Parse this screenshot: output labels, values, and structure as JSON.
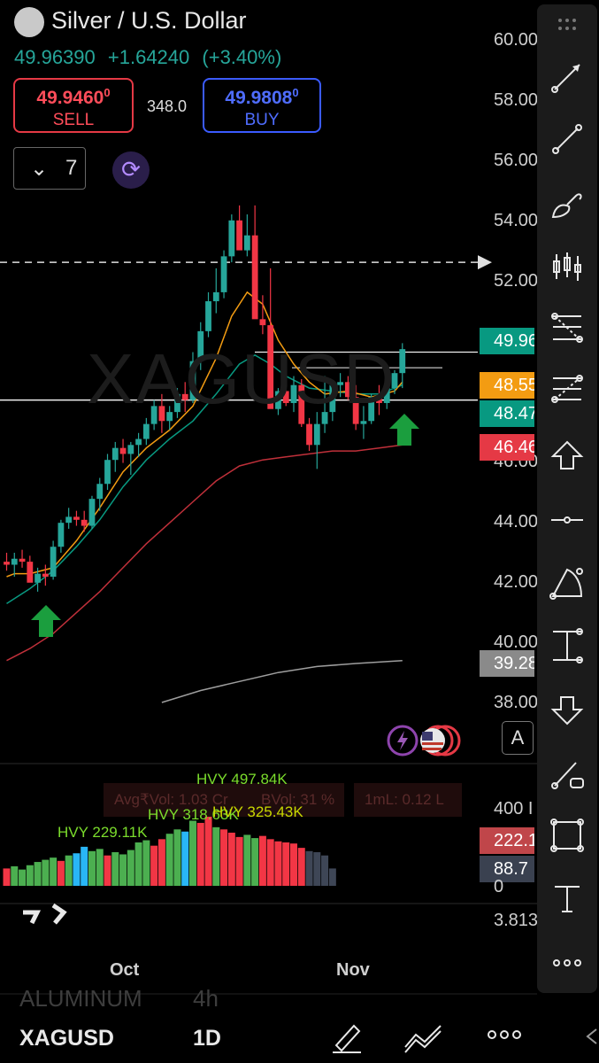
{
  "header": {
    "symbol_name": "Silver / U.S. Dollar",
    "last_price": "49.96390",
    "change_abs": "+1.64240",
    "change_pct": "(+3.40%)"
  },
  "trade": {
    "sell_price": "49.9460",
    "sell_price_sup": "0",
    "sell_label": "SELL",
    "spread": "348.0",
    "buy_price": "49.9808",
    "buy_price_sup": "0",
    "buy_label": "BUY"
  },
  "interval_selector": {
    "value": "7"
  },
  "watermark": "XAGUSD",
  "price_axis": [
    "60.00",
    "58.00",
    "56.00",
    "54.00",
    "52.00",
    "46.00",
    "44.00",
    "42.00",
    "40.00",
    "38.00"
  ],
  "price_tags": [
    {
      "label": "49.96",
      "color": "#089981"
    },
    {
      "label": "48.55",
      "color": "#f39c12"
    },
    {
      "label": "48.47",
      "color": "#089981"
    },
    {
      "label": "46.46",
      "color": "#e53945"
    },
    {
      "label": "39.28",
      "color": "#8a8a8a"
    }
  ],
  "volume_pane": {
    "avg_vol": "Avg₹Vol: 1.03 Cr",
    "bvol": "BVol: 31 %",
    "ml": "1mL: 0.12 L",
    "hvy_labels": [
      "HVY 497.84K",
      "HVY 229.11K",
      "HVY 318.63K",
      "HVY 325.43K"
    ],
    "axis_top": "400 I",
    "tag_red": "222.1",
    "tag_dark": "88.7",
    "axis_zero": "0",
    "osc_value": "3.813"
  },
  "time_axis": [
    "Oct",
    "Nov"
  ],
  "alert_label": "A",
  "bottom_bar": {
    "symbol": "XAGUSD",
    "interval": "1D",
    "ghost_symbol": "ALUMINUM",
    "ghost_interval": "4h"
  },
  "colors": {
    "up": "#26a69a",
    "down": "#f23645",
    "ema_fast": "#f39c12",
    "ema_mid": "#089981",
    "ema_slow": "#c0303a",
    "sma_long": "#9e9e9e",
    "vol_green": "#4caf50",
    "vol_red": "#f23645",
    "vol_blue": "#29b6f6"
  },
  "chart_data": {
    "type": "candlestick",
    "price_range": [
      37,
      61
    ],
    "candles": [
      [
        42.6,
        42.9,
        42.3,
        42.5
      ],
      [
        42.5,
        42.9,
        42.1,
        42.7
      ],
      [
        42.7,
        43.0,
        42.4,
        42.6
      ],
      [
        42.6,
        42.8,
        42.0,
        41.9
      ],
      [
        41.9,
        42.4,
        41.6,
        42.2
      ],
      [
        42.2,
        42.5,
        41.8,
        42.1
      ],
      [
        42.1,
        43.3,
        42.0,
        43.1
      ],
      [
        43.1,
        44.0,
        42.9,
        43.9
      ],
      [
        43.9,
        44.4,
        43.7,
        44.1
      ],
      [
        44.1,
        44.3,
        43.8,
        44.0
      ],
      [
        44.0,
        44.3,
        43.6,
        43.8
      ],
      [
        43.8,
        44.8,
        43.7,
        44.7
      ],
      [
        44.7,
        45.4,
        44.3,
        45.2
      ],
      [
        45.2,
        46.2,
        45.0,
        46.0
      ],
      [
        46.0,
        46.6,
        45.6,
        46.4
      ],
      [
        46.4,
        46.7,
        45.9,
        46.2
      ],
      [
        46.2,
        46.6,
        45.5,
        46.5
      ],
      [
        46.5,
        46.9,
        46.1,
        46.7
      ],
      [
        46.7,
        47.4,
        46.5,
        47.2
      ],
      [
        47.2,
        48.0,
        47.0,
        47.8
      ],
      [
        47.8,
        48.2,
        46.9,
        47.3
      ],
      [
        47.3,
        47.8,
        47.0,
        47.6
      ],
      [
        47.6,
        48.4,
        47.4,
        48.2
      ],
      [
        48.2,
        48.6,
        47.6,
        48.0
      ],
      [
        48.0,
        49.6,
        47.9,
        49.3
      ],
      [
        49.3,
        50.6,
        49.0,
        50.3
      ],
      [
        50.3,
        51.6,
        50.1,
        51.3
      ],
      [
        51.3,
        52.4,
        50.9,
        51.6
      ],
      [
        51.6,
        53.0,
        51.4,
        52.8
      ],
      [
        52.8,
        54.2,
        52.6,
        54.0
      ],
      [
        54.0,
        54.5,
        53.7,
        53.0
      ],
      [
        53.0,
        54.2,
        52.8,
        53.5
      ],
      [
        53.5,
        54.5,
        50.8,
        50.7
      ],
      [
        50.7,
        51.5,
        50.2,
        50.5
      ],
      [
        50.5,
        52.4,
        47.8,
        47.7
      ],
      [
        47.7,
        48.4,
        47.5,
        48.3
      ],
      [
        48.3,
        48.4,
        47.8,
        47.9
      ],
      [
        47.9,
        48.8,
        47.6,
        48.5
      ],
      [
        48.5,
        48.7,
        47.1,
        47.2
      ],
      [
        47.2,
        47.4,
        46.3,
        46.5
      ],
      [
        46.5,
        47.6,
        45.7,
        47.2
      ],
      [
        47.2,
        48.8,
        46.9,
        47.6
      ],
      [
        47.6,
        48.6,
        47.3,
        48.5
      ],
      [
        48.5,
        48.9,
        48.1,
        48.6
      ],
      [
        48.6,
        48.8,
        48.0,
        48.1
      ],
      [
        48.1,
        48.5,
        47.0,
        47.2
      ],
      [
        47.2,
        47.8,
        46.7,
        47.3
      ],
      [
        47.3,
        48.2,
        47.2,
        48.1
      ],
      [
        48.1,
        48.5,
        47.5,
        47.9
      ],
      [
        47.9,
        48.8,
        47.7,
        48.4
      ],
      [
        48.4,
        49.0,
        48.2,
        48.9
      ],
      [
        48.9,
        49.9,
        48.4,
        49.7
      ]
    ],
    "volumes": [
      [
        80,
        "r"
      ],
      [
        90,
        "g"
      ],
      [
        75,
        "g"
      ],
      [
        95,
        "g"
      ],
      [
        110,
        "g"
      ],
      [
        120,
        "g"
      ],
      [
        130,
        "g"
      ],
      [
        115,
        "r"
      ],
      [
        140,
        "g"
      ],
      [
        150,
        "b"
      ],
      [
        180,
        "b"
      ],
      [
        160,
        "g"
      ],
      [
        170,
        "g"
      ],
      [
        140,
        "r"
      ],
      [
        155,
        "g"
      ],
      [
        145,
        "g"
      ],
      [
        165,
        "g"
      ],
      [
        200,
        "g"
      ],
      [
        210,
        "g"
      ],
      [
        185,
        "r"
      ],
      [
        215,
        "r"
      ],
      [
        240,
        "g"
      ],
      [
        260,
        "g"
      ],
      [
        250,
        "b"
      ],
      [
        300,
        "g"
      ],
      [
        290,
        "r"
      ],
      [
        320,
        "r"
      ],
      [
        270,
        "g"
      ],
      [
        260,
        "r"
      ],
      [
        245,
        "r"
      ],
      [
        225,
        "r"
      ],
      [
        235,
        "g"
      ],
      [
        220,
        "g"
      ],
      [
        230,
        "r"
      ],
      [
        215,
        "r"
      ],
      [
        205,
        "r"
      ],
      [
        200,
        "r"
      ],
      [
        195,
        "r"
      ],
      [
        175,
        "r"
      ],
      [
        160,
        "k"
      ],
      [
        155,
        "k"
      ],
      [
        140,
        "k"
      ],
      [
        80,
        "k"
      ]
    ],
    "ema_fast": [
      [
        0,
        42.1
      ],
      [
        1,
        42.2
      ],
      [
        3,
        42.2
      ],
      [
        6,
        42.4
      ],
      [
        9,
        43.3
      ],
      [
        12,
        44.4
      ],
      [
        15,
        45.6
      ],
      [
        18,
        46.4
      ],
      [
        21,
        47.0
      ],
      [
        24,
        47.8
      ],
      [
        27,
        49.4
      ],
      [
        29,
        50.8
      ],
      [
        31,
        51.6
      ],
      [
        33,
        51.2
      ],
      [
        35,
        50.0
      ],
      [
        37,
        49.2
      ],
      [
        39,
        48.6
      ],
      [
        41,
        48.2
      ],
      [
        44,
        48.3
      ],
      [
        47,
        48.1
      ],
      [
        50,
        48.3
      ],
      [
        51,
        48.6
      ]
    ],
    "ema_mid": [
      [
        0,
        41.2
      ],
      [
        3,
        41.7
      ],
      [
        6,
        42.3
      ],
      [
        9,
        43.1
      ],
      [
        12,
        44.0
      ],
      [
        15,
        45.1
      ],
      [
        18,
        46.0
      ],
      [
        21,
        46.7
      ],
      [
        24,
        47.3
      ],
      [
        27,
        48.2
      ],
      [
        30,
        49.2
      ],
      [
        32,
        49.5
      ],
      [
        34,
        49.2
      ],
      [
        36,
        48.8
      ],
      [
        39,
        48.4
      ],
      [
        42,
        48.3
      ],
      [
        45,
        48.2
      ],
      [
        48,
        48.2
      ],
      [
        51,
        48.5
      ]
    ],
    "ema_slow": [
      [
        0,
        39.3
      ],
      [
        3,
        39.7
      ],
      [
        6,
        40.2
      ],
      [
        9,
        40.9
      ],
      [
        12,
        41.6
      ],
      [
        15,
        42.4
      ],
      [
        18,
        43.2
      ],
      [
        21,
        43.9
      ],
      [
        24,
        44.6
      ],
      [
        27,
        45.3
      ],
      [
        30,
        45.8
      ],
      [
        33,
        46.0
      ],
      [
        36,
        46.1
      ],
      [
        39,
        46.2
      ],
      [
        42,
        46.3
      ],
      [
        45,
        46.3
      ],
      [
        48,
        46.4
      ],
      [
        51,
        46.5
      ]
    ],
    "sma_long": [
      [
        20,
        37.9
      ],
      [
        25,
        38.3
      ],
      [
        30,
        38.6
      ],
      [
        35,
        38.9
      ],
      [
        40,
        39.1
      ],
      [
        45,
        39.2
      ],
      [
        51,
        39.3
      ]
    ]
  }
}
